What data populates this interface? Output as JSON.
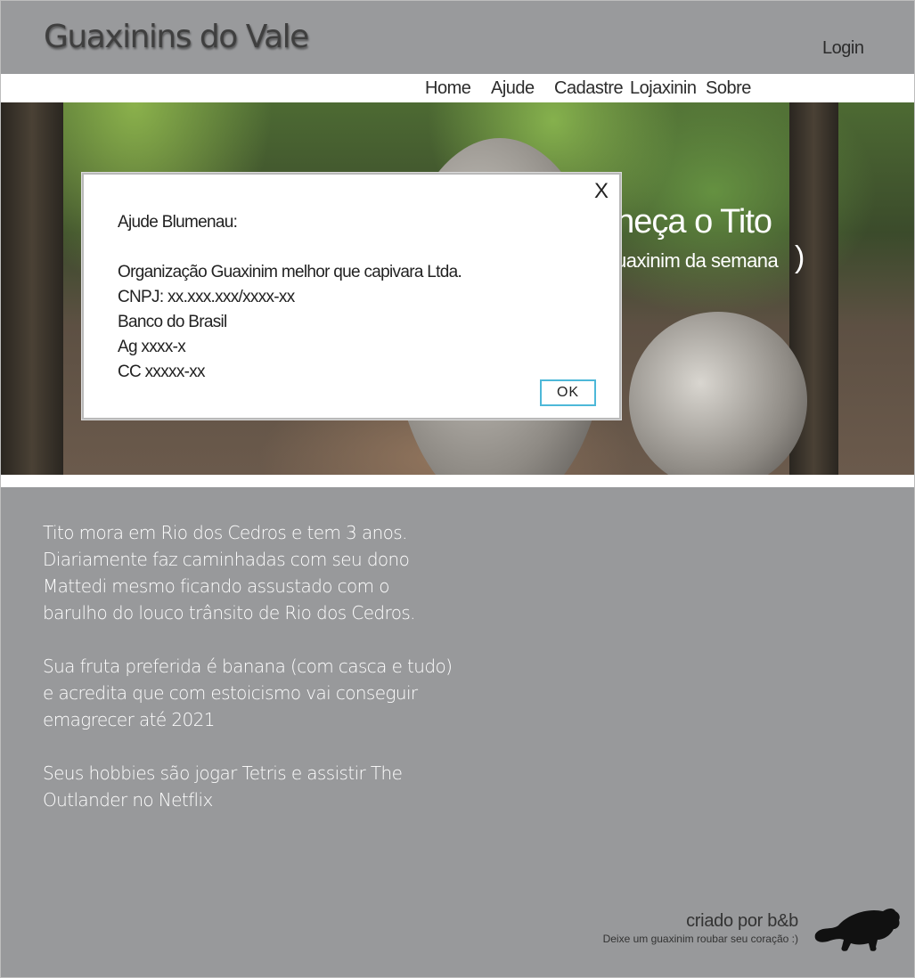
{
  "header": {
    "title": "Guaxinins do Vale",
    "login_label": "Login"
  },
  "nav": {
    "items": [
      {
        "label": "Home"
      },
      {
        "label": "Ajude"
      },
      {
        "label": "Cadastre"
      },
      {
        "label": "Lojaxinin"
      },
      {
        "label": "Sobre"
      }
    ]
  },
  "hero": {
    "heading_visible": "nheça o Tito",
    "subtitle_visible": "uaxinim da semana",
    "closing_paren": ")"
  },
  "dialog": {
    "close_label": "X",
    "lines": [
      "Ajude Blumenau:",
      "Organização Guaxinim melhor que capivara Ltda.",
      "CNPJ: xx.xxx.xxx/xxxx-xx",
      "Banco do Brasil",
      "Ag xxxx-x",
      "CC xxxxx-xx"
    ],
    "ok_label": "OK"
  },
  "story": {
    "paragraphs": [
      "Tito mora em Rio dos Cedros e tem 3 anos. Diariamente faz caminhadas com seu dono Mattedi mesmo ficando assustado com o barulho do louco trânsito de Rio dos Cedros.",
      "Sua fruta preferida é banana (com casca e tudo) e acredita que com estoicismo vai conseguir emagrecer até 2021",
      "Seus hobbies são  jogar Tetris e assistir The Outlander no Netflix"
    ]
  },
  "footer": {
    "credit": "criado por b&b",
    "tagline": "Deixe um guaxinim roubar seu coração :)",
    "logo_icon": "raccoon-icon"
  },
  "colors": {
    "header_bg": "#999a9c",
    "content_bg": "#98999b",
    "ok_border": "#4db8d8"
  }
}
